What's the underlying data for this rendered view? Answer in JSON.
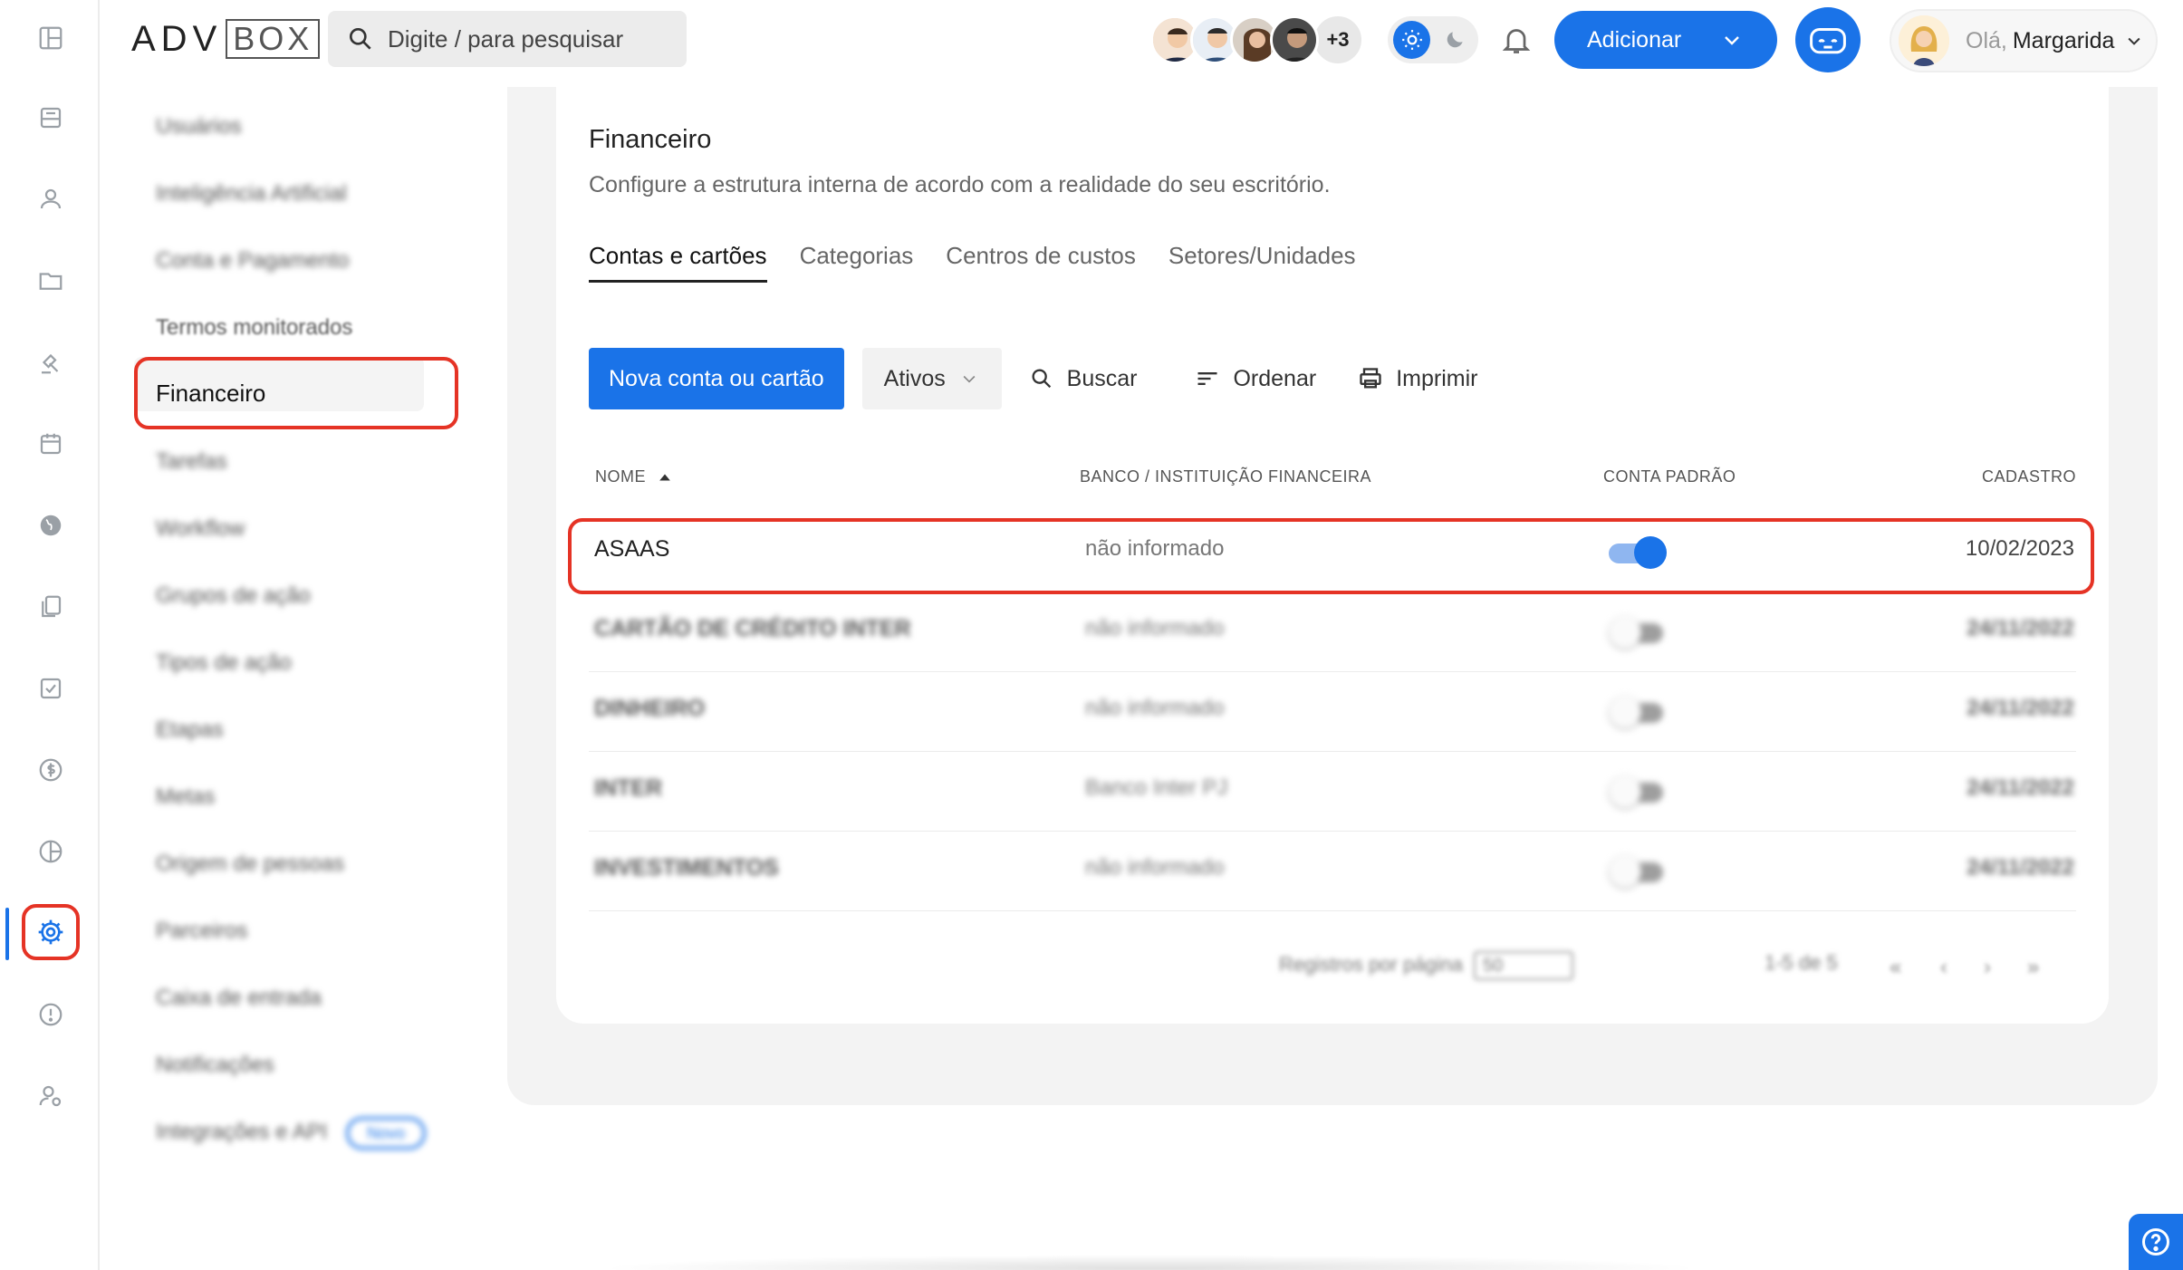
{
  "header": {
    "logo_left": "ADV",
    "logo_right": "BOX",
    "search_placeholder": "Digite / para pesquisar",
    "avatars_more": "+3",
    "add_label": "Adicionar",
    "greeting": "Olá,",
    "user_name": "Margarida"
  },
  "rail": {
    "icons": [
      "dashboard-icon",
      "inbox-icon",
      "people-icon",
      "folder-icon",
      "gavel-icon",
      "calendar-icon",
      "globe-icon",
      "documents-icon",
      "checklist-icon",
      "money-icon",
      "pie-chart-icon",
      "gear-icon",
      "alert-icon",
      "user-settings-icon"
    ],
    "active": "gear-icon"
  },
  "submenu": {
    "items": [
      {
        "label": "Usuários"
      },
      {
        "label": "Inteligência Artificial"
      },
      {
        "label": "Conta e Pagamento"
      },
      {
        "label": "Termos monitorados"
      },
      {
        "label": "Financeiro"
      },
      {
        "label": "Tarefas"
      },
      {
        "label": "Workflow"
      },
      {
        "label": "Grupos de ação"
      },
      {
        "label": "Tipos de ação"
      },
      {
        "label": "Etapas"
      },
      {
        "label": "Metas"
      },
      {
        "label": "Origem de pessoas"
      },
      {
        "label": "Parceiros"
      },
      {
        "label": "Caixa de entrada"
      },
      {
        "label": "Notificações"
      },
      {
        "label": "Integrações e API"
      }
    ],
    "active_label": "Financeiro",
    "badge_novo": "Novo"
  },
  "main": {
    "title": "Financeiro",
    "subtitle": "Configure a estrutura interna de acordo com a realidade do seu escritório.",
    "tabs": [
      {
        "label": "Contas e cartões"
      },
      {
        "label": "Categorias"
      },
      {
        "label": "Centros de custos"
      },
      {
        "label": "Setores/Unidades"
      }
    ],
    "toolbar": {
      "new_label": "Nova conta ou cartão",
      "filter_label": "Ativos",
      "search_label": "Buscar",
      "sort_label": "Ordenar",
      "print_label": "Imprimir"
    },
    "table": {
      "headers": {
        "name": "NOME",
        "bank": "BANCO / INSTITUIÇÃO FINANCEIRA",
        "default": "CONTA PADRÃO",
        "created": "CADASTRO"
      },
      "rows": [
        {
          "name": "ASAAS",
          "bank": "não informado",
          "default": true,
          "created": "10/02/2023"
        },
        {
          "name": "CARTÃO DE CRÉDITO INTER",
          "bank": "não informado",
          "default": false,
          "created": "24/11/2022"
        },
        {
          "name": "DINHEIRO",
          "bank": "não informado",
          "default": false,
          "created": "24/11/2022"
        },
        {
          "name": "INTER",
          "bank": "Banco Inter PJ",
          "default": false,
          "created": "24/11/2022"
        },
        {
          "name": "INVESTIMENTOS",
          "bank": "não informado",
          "default": false,
          "created": "24/11/2022"
        }
      ]
    },
    "pagination": {
      "per_page_label": "Registros por página",
      "per_page_value": "50",
      "range": "1-5 de 5",
      "first": "«",
      "prev": "‹",
      "next": "›",
      "last": "»"
    }
  },
  "colors": {
    "accent": "#1a73e8",
    "highlight": "#e53325"
  }
}
